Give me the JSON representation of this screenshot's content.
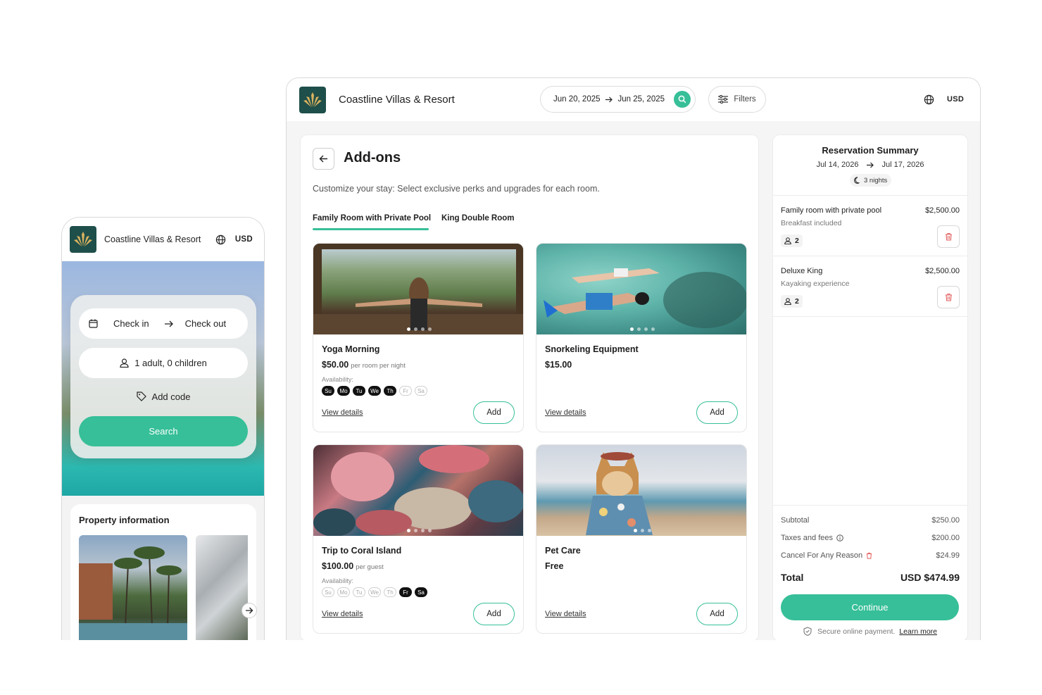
{
  "brand": {
    "name": "Coastline Villas & Resort",
    "color": "#1f4f4a",
    "accent": "#36bf98"
  },
  "mobile": {
    "header": {
      "title": "Coastline Villas & Resort",
      "currency": "USD"
    },
    "search": {
      "check_in": "Check in",
      "check_out": "Check out",
      "guests": "1 adult, 0 children",
      "add_code": "Add code",
      "search_button": "Search"
    },
    "property": {
      "title": "Property information"
    }
  },
  "desktop": {
    "header": {
      "title": "Coastline Villas & Resort",
      "date_from": "Jun 20, 2025",
      "date_to": "Jun 25, 2025",
      "filters": "Filters",
      "currency": "USD"
    },
    "addons": {
      "title": "Add-ons",
      "subtitle": "Customize your stay: Select exclusive perks and upgrades for each room.",
      "tabs": [
        "Family Room with Private Pool",
        "King Double Room"
      ],
      "active_tab": 0,
      "cards": [
        {
          "name": "Yoga Morning",
          "price": "$50.00",
          "unit": "per room per night",
          "availability_label": "Availability:",
          "days": [
            {
              "d": "Su",
              "on": true
            },
            {
              "d": "Mo",
              "on": true
            },
            {
              "d": "Tu",
              "on": true
            },
            {
              "d": "We",
              "on": true
            },
            {
              "d": "Th",
              "on": true
            },
            {
              "d": "Fr",
              "on": false
            },
            {
              "d": "Sa",
              "on": false
            }
          ],
          "link": "View details",
          "add": "Add",
          "image": "yoga"
        },
        {
          "name": "Snorkeling Equipment",
          "price": "$15.00",
          "unit": "",
          "availability_label": "",
          "days": [],
          "link": "View details",
          "add": "Add",
          "image": "snork"
        },
        {
          "name": "Trip to Coral Island",
          "price": "$100.00",
          "unit": "per guest",
          "availability_label": "Availability:",
          "days": [
            {
              "d": "Su",
              "on": false
            },
            {
              "d": "Mo",
              "on": false
            },
            {
              "d": "Tu",
              "on": false
            },
            {
              "d": "We",
              "on": false
            },
            {
              "d": "Th",
              "on": false
            },
            {
              "d": "Fr",
              "on": true
            },
            {
              "d": "Sa",
              "on": true
            }
          ],
          "link": "View details",
          "add": "Add",
          "image": "coral"
        },
        {
          "name": "Pet Care",
          "price": "Free",
          "unit": "",
          "availability_label": "",
          "days": [],
          "link": "View details",
          "add": "Add",
          "image": "pet"
        }
      ]
    },
    "summary": {
      "title": "Reservation Summary",
      "date_from": "Jul 14, 2026",
      "date_to": "Jul 17, 2026",
      "nights": "3 nights",
      "items": [
        {
          "name": "Family room with private pool",
          "price": "$2,500.00",
          "sub": "Breakfast included",
          "guests": "2"
        },
        {
          "name": "Deluxe King",
          "price": "$2,500.00",
          "sub": "Kayaking experience",
          "guests": "2"
        }
      ],
      "subtotal_label": "Subtotal",
      "subtotal": "$250.00",
      "taxes_label": "Taxes and fees",
      "taxes": "$200.00",
      "cancel_label": "Cancel For Any Reason",
      "cancel": "$24.99",
      "total_label": "Total",
      "total": "USD $474.99",
      "continue": "Continue",
      "secure": "Secure online payment.",
      "learn_more": "Learn more"
    }
  }
}
